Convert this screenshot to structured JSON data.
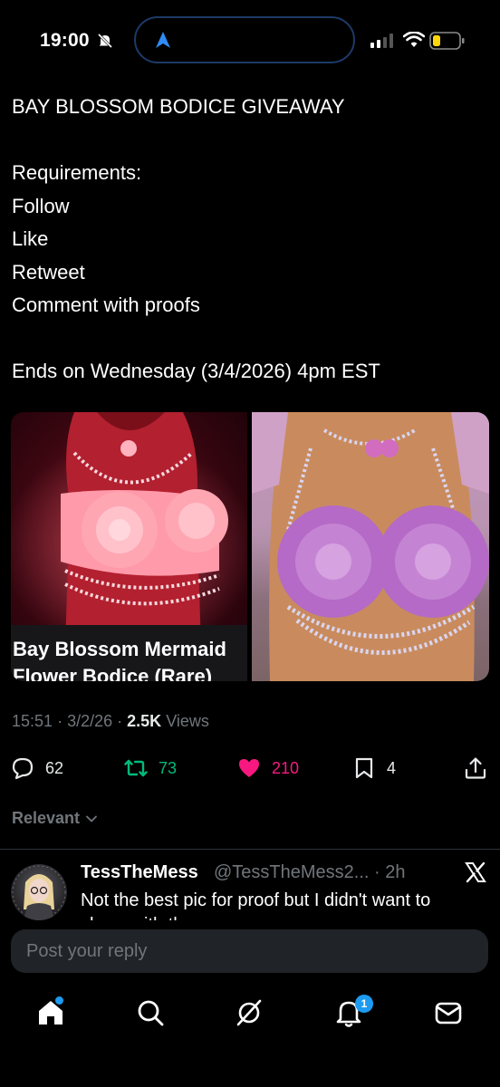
{
  "status_bar": {
    "time": "19:00",
    "icons": [
      "mute-bell-icon",
      "location-arrow-icon",
      "signal-icon",
      "wifi-icon",
      "battery-low-icon"
    ]
  },
  "tweet": {
    "text": "BAY BLOSSOM BODICE GIVEAWAY\n\nRequirements:\nFollow\nLike\nRetweet\nComment with proofs\n\nEnds on Wednesday (3/4/2026) 4pm EST",
    "media_caption": "Bay Blossom Mermaid\nFlower Bodice (Rare)",
    "time": "15:51",
    "date": "3/2/26",
    "sep": "·",
    "views_count": "2.5K",
    "views_label": "Views"
  },
  "actions": {
    "replies": "62",
    "retweets": "73",
    "likes": "210",
    "bookmarks": "4"
  },
  "sort_label": "Relevant",
  "reply": {
    "name": "TessTheMess",
    "handle_time": "@TessTheMess2... · 2h",
    "text": "Not the best pic for proof but I didn't want to",
    "text2": "share with the"
  },
  "composer": {
    "placeholder": "Post your reply"
  },
  "tabbar": {
    "notification_badge": "1"
  },
  "colors": {
    "accent": "#1d9bf0",
    "retweet": "#00ba7c",
    "like": "#f91880",
    "muted": "#71767b"
  }
}
